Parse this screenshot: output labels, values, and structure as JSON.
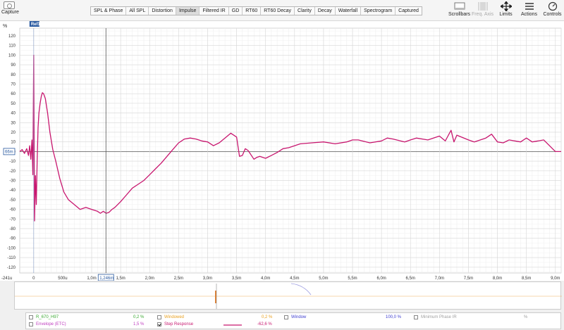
{
  "toolbar": {
    "capture_label": "Capture",
    "tabs": [
      "SPL & Phase",
      "All SPL",
      "Distortion",
      "Impulse",
      "Filtered IR",
      "GD",
      "RT60",
      "RT60 Decay",
      "Clarity",
      "Decay",
      "Waterfall",
      "Spectrogram",
      "Captured"
    ],
    "active_tab": "Impulse",
    "tools": [
      {
        "label": "Scrollbars",
        "icon": "scrollbars-icon",
        "enabled": true
      },
      {
        "label": "Freq. Axis",
        "icon": "freq-axis-icon",
        "enabled": false
      },
      {
        "label": "Limits",
        "icon": "limits-icon",
        "enabled": true
      },
      {
        "label": "Actions",
        "icon": "actions-icon",
        "enabled": true
      },
      {
        "label": "Controls",
        "icon": "controls-icon",
        "enabled": true
      }
    ]
  },
  "plot": {
    "y_unit": "%",
    "ref_label": "Ref1",
    "cursor_y_readout": "66m",
    "cursor_x_readout": "1,246m",
    "x_start_readout": "-241u"
  },
  "chart_data": {
    "type": "line",
    "title": "",
    "xlabel": "",
    "ylabel": "%",
    "xlim": [
      -0.241,
      9.1
    ],
    "ylim": [
      -126,
      128
    ],
    "y_ticks": [
      120,
      110,
      100,
      90,
      80,
      70,
      60,
      50,
      40,
      30,
      20,
      10,
      0,
      -10,
      -20,
      -30,
      -40,
      -50,
      -60,
      -70,
      -80,
      -90,
      -100,
      -110,
      -120
    ],
    "x_ticks": [
      {
        "value": 0,
        "label": "0"
      },
      {
        "value": 0.5,
        "label": "500u"
      },
      {
        "value": 1.0,
        "label": "1,0m"
      },
      {
        "value": 1.5,
        "label": "1,5m"
      },
      {
        "value": 2.0,
        "label": "2,0m"
      },
      {
        "value": 2.5,
        "label": "2,5m"
      },
      {
        "value": 3.0,
        "label": "3,0m"
      },
      {
        "value": 3.5,
        "label": "3,5m"
      },
      {
        "value": 4.0,
        "label": "4,0m"
      },
      {
        "value": 4.5,
        "label": "4,5m"
      },
      {
        "value": 5.0,
        "label": "5,0m"
      },
      {
        "value": 5.5,
        "label": "5,5m"
      },
      {
        "value": 6.0,
        "label": "6,0m"
      },
      {
        "value": 6.5,
        "label": "6,5m"
      },
      {
        "value": 7.0,
        "label": "7,0m"
      },
      {
        "value": 7.5,
        "label": "7,5m"
      },
      {
        "value": 8.0,
        "label": "8,0m"
      },
      {
        "value": 8.5,
        "label": "8,5m"
      },
      {
        "value": 9.0,
        "label": "9,0m"
      }
    ],
    "grid": true,
    "cursor_x": 1.246,
    "series": [
      {
        "name": "Step Response",
        "color": "#c8176f",
        "x": [
          -0.241,
          -0.2,
          -0.16,
          -0.12,
          -0.09,
          -0.07,
          -0.05,
          -0.03,
          -0.015,
          0.0,
          0.015,
          0.03,
          0.045,
          0.06,
          0.075,
          0.09,
          0.11,
          0.13,
          0.15,
          0.17,
          0.2,
          0.24,
          0.28,
          0.33,
          0.38,
          0.45,
          0.52,
          0.6,
          0.7,
          0.8,
          0.9,
          1.0,
          1.1,
          1.15,
          1.2,
          1.25,
          1.3,
          1.35,
          1.4,
          1.5,
          1.6,
          1.7,
          1.8,
          1.9,
          2.0,
          2.1,
          2.2,
          2.3,
          2.4,
          2.5,
          2.6,
          2.7,
          2.8,
          2.9,
          3.0,
          3.1,
          3.2,
          3.3,
          3.4,
          3.5,
          3.55,
          3.6,
          3.65,
          3.7,
          3.8,
          3.85,
          3.9,
          4.0,
          4.1,
          4.2,
          4.3,
          4.4,
          4.5,
          4.6,
          4.8,
          5.0,
          5.2,
          5.4,
          5.5,
          5.6,
          5.8,
          6.0,
          6.1,
          6.2,
          6.4,
          6.5,
          6.6,
          6.8,
          7.0,
          7.1,
          7.2,
          7.25,
          7.3,
          7.5,
          7.6,
          7.8,
          7.9,
          8.0,
          8.1,
          8.2,
          8.4,
          8.5,
          8.6,
          8.8,
          9.0,
          9.1
        ],
        "y": [
          0,
          2,
          -2,
          3,
          -4,
          6,
          -8,
          12,
          -24,
          100,
          -72,
          -25,
          -55,
          -10,
          25,
          40,
          50,
          57,
          61,
          60,
          55,
          40,
          20,
          2,
          -10,
          -28,
          -42,
          -50,
          -55,
          -60,
          -58,
          -60,
          -62,
          -64,
          -62,
          -64,
          -63,
          -60,
          -58,
          -52,
          -45,
          -38,
          -34,
          -30,
          -24,
          -18,
          -12,
          -5,
          2,
          9,
          13,
          14,
          13,
          11,
          10,
          6,
          9,
          14,
          19,
          15,
          -5,
          -4,
          3,
          1,
          -8,
          -6,
          -5,
          -7,
          -4,
          -1,
          3,
          4,
          6,
          8,
          9,
          10,
          8,
          10,
          12,
          12,
          9,
          11,
          14,
          13,
          10,
          12,
          14,
          12,
          16,
          11,
          22,
          10,
          17,
          12,
          10,
          14,
          18,
          10,
          9,
          12,
          10,
          14,
          10,
          12,
          0,
          0
        ]
      }
    ]
  },
  "overview": {
    "description_points": [
      0.03,
      0.18
    ]
  },
  "legend": {
    "items": [
      {
        "label": "R_670_H97",
        "value": "0,2 %",
        "color": "#3aa832",
        "checked": false,
        "swatch": false
      },
      {
        "label": "Windowed",
        "value": "0,2 %",
        "color": "#e8a020",
        "checked": false,
        "swatch": false
      },
      {
        "label": "Window",
        "value": "100,0 %",
        "color": "#4040d0",
        "checked": false,
        "swatch": false
      },
      {
        "label": "Minimum Phase IR",
        "value": "%",
        "color": "#a0a0a0",
        "checked": false,
        "swatch": false
      },
      {
        "label": "Envelope (ETC)",
        "value": "1,5 %",
        "color": "#c040c0",
        "checked": false,
        "swatch": false
      },
      {
        "label": "Step Response",
        "value": "-62,6 %",
        "color": "#c8176f",
        "checked": true,
        "swatch": true
      }
    ]
  }
}
